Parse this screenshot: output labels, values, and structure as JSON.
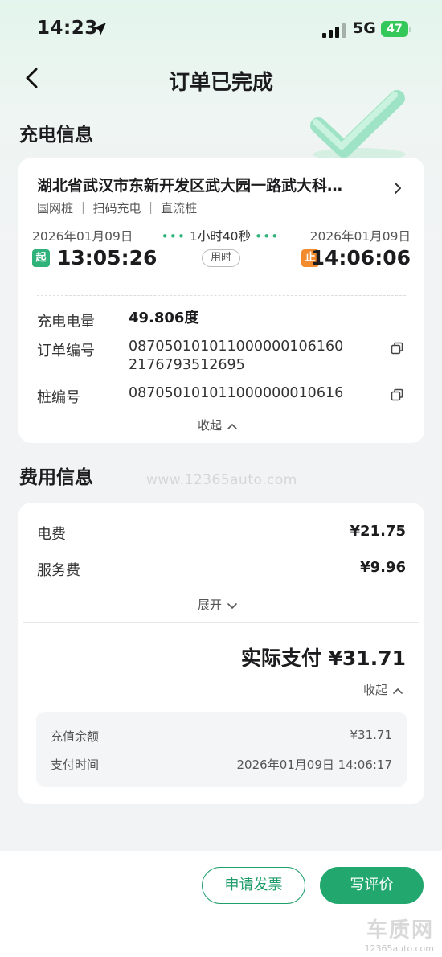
{
  "status_bar": {
    "time": "14:23",
    "network": "5G",
    "battery": "47"
  },
  "nav": {
    "title": "订单已完成"
  },
  "charging": {
    "section_title": "充电信息",
    "address": "湖北省武汉市东新开发区武大园一路武大科…",
    "tags": "国网桩 ｜ 扫码充电 ｜ 直流桩",
    "start_date": "2026年01月09日",
    "end_date": "2026年01月09日",
    "duration": "1小时40秒",
    "duration_label": "用时",
    "start_badge": "起",
    "end_badge": "止",
    "start_time": "13:05:26",
    "end_time": "14:06:06",
    "energy_label": "充电电量",
    "energy_value": "49.806度",
    "order_label": "订单编号",
    "order_value_line1": "087050101011000000106160",
    "order_value_line2": "2176793512695",
    "pile_label": "桩编号",
    "pile_value": "087050101011000000010616",
    "collapse_label": "收起"
  },
  "fees": {
    "section_title": "费用信息",
    "electricity_label": "电费",
    "electricity_value": "¥21.75",
    "service_label": "服务费",
    "service_value": "¥9.96",
    "expand_label": "展开",
    "actual_label": "实际支付 ¥31.71",
    "collapse_label": "收起",
    "balance_label": "充值余额",
    "balance_value": "¥31.71",
    "pay_time_label": "支付时间",
    "pay_time_value": "2026年01月09日 14:06:17"
  },
  "actions": {
    "invoice_button": "申请发票",
    "review_button": "写评价"
  },
  "watermark": {
    "middle": "www.12365auto.com",
    "logo": "车质网",
    "url": "12365auto.com"
  },
  "colors": {
    "accent_green": "#22a86f",
    "start_badge": "#2fb37a",
    "end_badge": "#f28a2e",
    "battery": "#34c759"
  }
}
